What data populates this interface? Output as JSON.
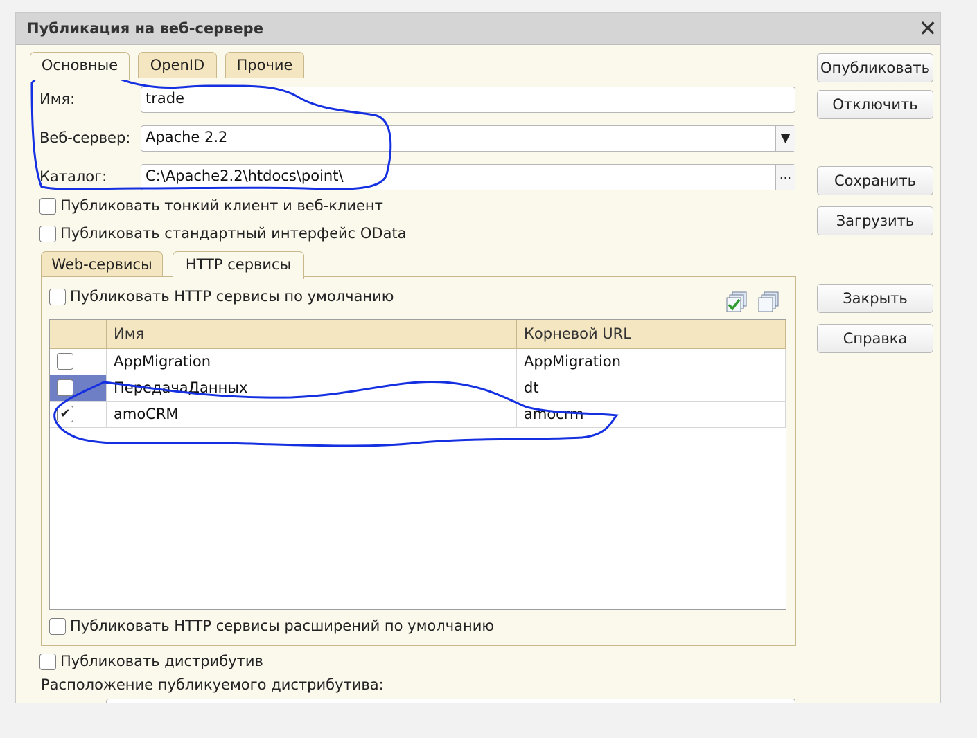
{
  "window": {
    "title": "Публикация на веб-сервере",
    "close_label": "✕"
  },
  "tabs": [
    {
      "label": "Основные",
      "active": true
    },
    {
      "label": "OpenID",
      "active": false
    },
    {
      "label": "Прочие",
      "active": false
    }
  ],
  "form": {
    "name_label": "Имя:",
    "name_value": "trade",
    "webserver_label": "Веб-сервер:",
    "webserver_value": "Apache 2.2",
    "catalog_label": "Каталог:",
    "catalog_value": "C:\\Apache2.2\\htdocs\\point\\",
    "catalog_button": "...",
    "publish_thin_client": {
      "label": "Публиковать тонкий клиент и веб-клиент",
      "checked": false
    },
    "publish_odata": {
      "label": "Публиковать стандартный интерфейс OData",
      "checked": false
    }
  },
  "subtabs": [
    {
      "label": "Web-сервисы",
      "active": false
    },
    {
      "label": "HTTP сервисы",
      "active": true
    }
  ],
  "http_services": {
    "publish_default": {
      "label": "Публиковать HTTP сервисы по умолчанию",
      "checked": false
    },
    "columns": [
      "Имя",
      "Корневой URL"
    ],
    "rows": [
      {
        "checked": false,
        "name": "AppMigration",
        "url": "AppMigration",
        "selected": false
      },
      {
        "checked": false,
        "name": "ПередачаДанных",
        "url": "dt",
        "selected": true
      },
      {
        "checked": true,
        "name": "amoCRM",
        "url": "amocrm",
        "selected": false
      }
    ],
    "publish_extensions": {
      "label": "Публиковать HTTP сервисы расширений по умолчанию",
      "checked": false
    }
  },
  "distribution": {
    "publish": {
      "label": "Публиковать дистрибутив",
      "checked": false
    },
    "location_label": "Расположение публикуемого дистрибутива:"
  },
  "buttons": {
    "publish": "Опубликовать",
    "disable": "Отключить",
    "save": "Сохранить",
    "load": "Загрузить",
    "close": "Закрыть",
    "help": "Справка"
  },
  "icons": {
    "check_all": "check-all-icon",
    "uncheck_all": "uncheck-all-icon"
  },
  "annotation_color": "#1530e0"
}
